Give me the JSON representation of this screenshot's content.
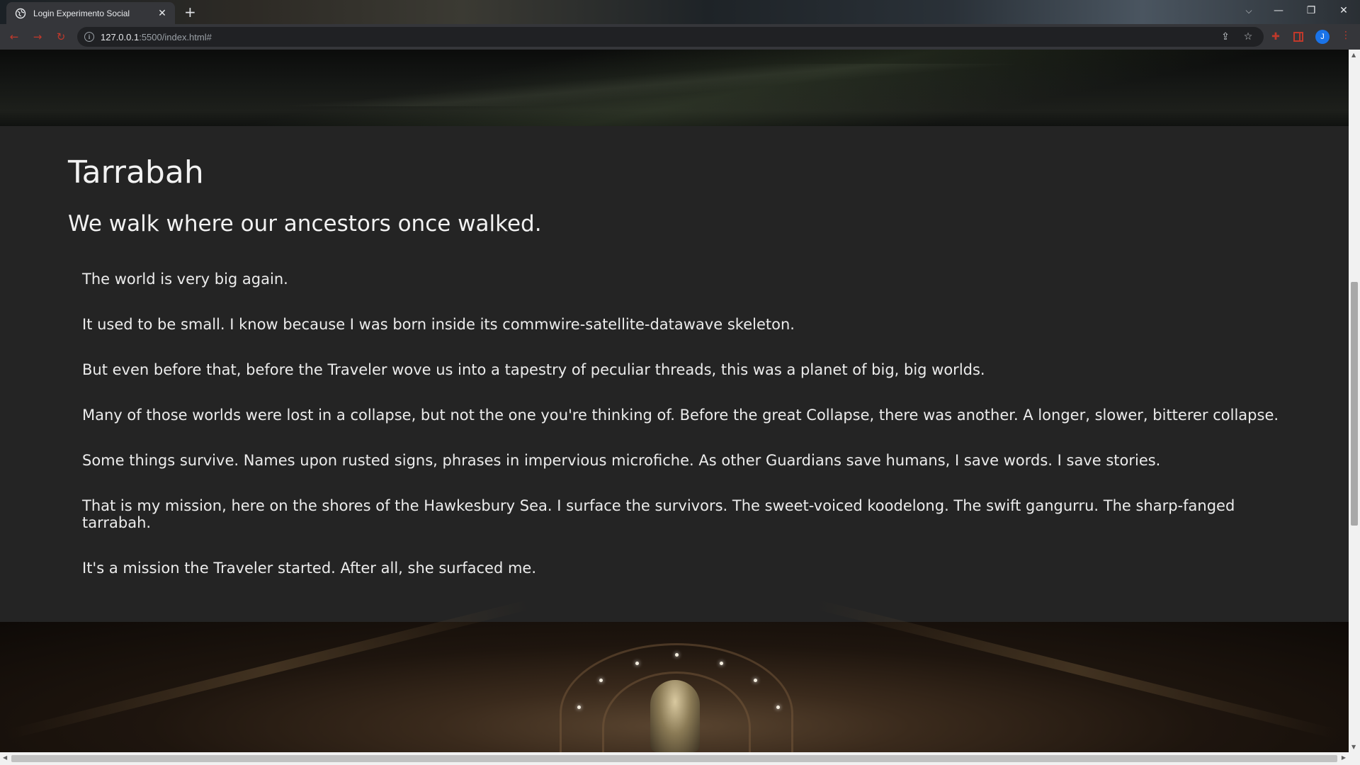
{
  "browser": {
    "tab_title": "Login Experimento Social",
    "tab_close": "✕",
    "new_tab": "+",
    "url_host": "127.0.0.1",
    "url_path": ":5500/index.html#",
    "profile_initial": "J",
    "window_controls": {
      "minimize": "—",
      "restore": "❐",
      "close": "✕"
    }
  },
  "article": {
    "title": "Tarrabah",
    "subtitle": "We walk where our ancestors once walked.",
    "paragraphs": [
      "The world is very big again.",
      "It used to be small. I know because I was born inside its commwire-satellite-datawave skeleton.",
      "But even before that, before the Traveler wove us into a tapestry of peculiar threads, this was a planet of big, big worlds.",
      "Many of those worlds were lost in a collapse, but not the one you're thinking of. Before the great Collapse, there was another. A longer, slower, bitterer collapse.",
      "Some things survive. Names upon rusted signs, phrases in impervious microfiche. As other Guardians save humans, I save words. I save stories.",
      "That is my mission, here on the shores of the Hawkesbury Sea. I surface the survivors. The sweet-voiced koodelong. The swift gangurru. The sharp-fanged tarrabah.",
      "It's a mission the Traveler started. After all, she surfaced me."
    ]
  },
  "colors": {
    "page_bg": "#242424",
    "text": "#ececec",
    "accent_red": "#c0392b",
    "profile_blue": "#1a73e8"
  }
}
